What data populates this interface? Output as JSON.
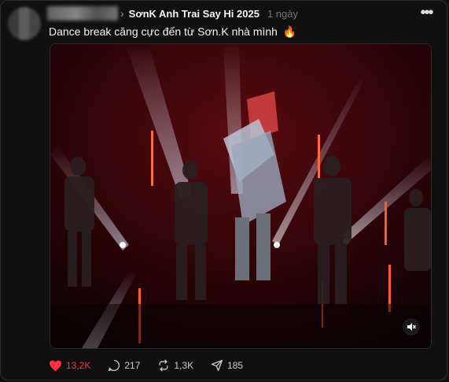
{
  "post": {
    "community": "SơnK Anh Trai Say Hi 2025",
    "time": "1 ngày",
    "caption": "Dance break căng cực đến từ Sơn.K nhà mình",
    "caption_emoji": "🔥"
  },
  "actions": {
    "likes": "13,2K",
    "comments": "217",
    "reposts": "1,3K",
    "shares": "185"
  },
  "colors": {
    "background": "#101010",
    "like": "#ff3040",
    "text": "#f3f5f7",
    "muted": "#777777"
  },
  "icons": [
    "avatar",
    "chevron-right-icon",
    "more-icon",
    "mute-icon",
    "heart-icon",
    "comment-icon",
    "repost-icon",
    "share-icon"
  ]
}
